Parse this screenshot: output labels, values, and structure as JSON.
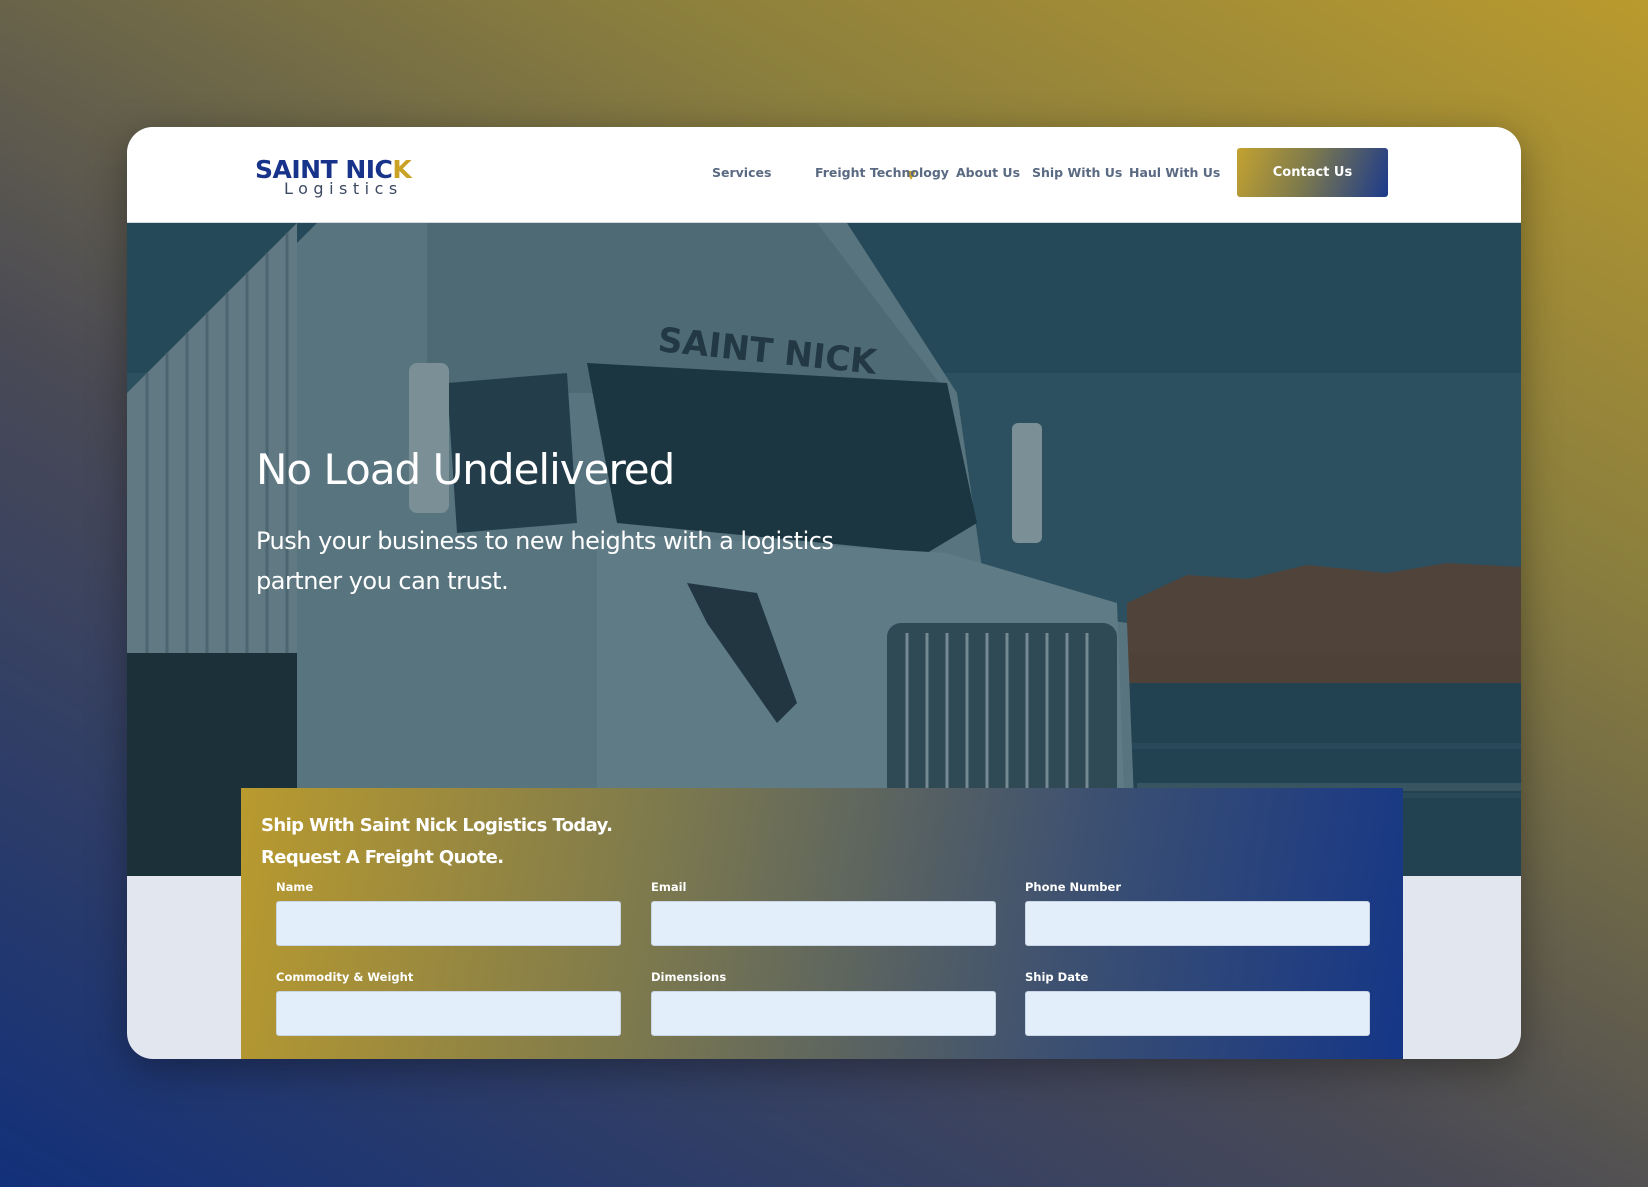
{
  "brand": {
    "name_main": "SAINT NIC",
    "name_accent": "K",
    "name_sub": "Logistics",
    "colors": {
      "navy": "#17338a",
      "gold": "#c9a226"
    }
  },
  "nav": {
    "items": [
      {
        "label": "Services",
        "has_dropdown": true
      },
      {
        "label": "Freight Technology"
      },
      {
        "label": "About Us"
      },
      {
        "label": "Ship With Us"
      },
      {
        "label": "Haul With Us"
      }
    ],
    "cta_label": "Contact Us"
  },
  "hero": {
    "title": "No Load Undelivered",
    "subtitle": "Push your business to new heights with a logistics partner you can trust.",
    "truck_branding": "SAINT NICK"
  },
  "quote_form": {
    "title_line1": "Ship With Saint Nick Logistics Today.",
    "title_line2": "Request A Freight Quote.",
    "fields": [
      {
        "label": "Name",
        "value": ""
      },
      {
        "label": "Email",
        "value": ""
      },
      {
        "label": "Phone Number",
        "value": ""
      },
      {
        "label": "Commodity & Weight",
        "value": ""
      },
      {
        "label": "Dimensions",
        "value": ""
      },
      {
        "label": "Ship Date",
        "value": ""
      }
    ]
  }
}
